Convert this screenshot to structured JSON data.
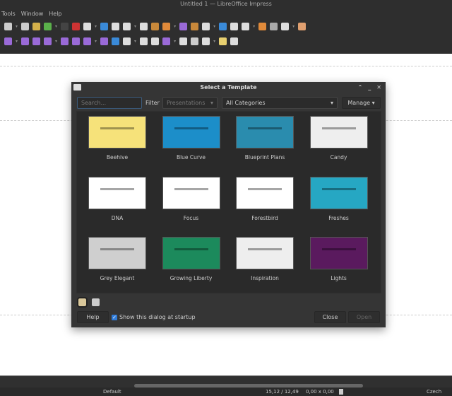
{
  "window": {
    "title": "Untitled 1 — LibreOffice Impress"
  },
  "menu": [
    "Tools",
    "Window",
    "Help"
  ],
  "dialog": {
    "title": "Select a Template",
    "search_placeholder": "Search...",
    "filter_label": "Filter",
    "filter_value": "Presentations",
    "category_value": "All Categories",
    "manage_label": "Manage",
    "templates": [
      {
        "name": "Beehive",
        "color": "#f6e27a"
      },
      {
        "name": "Blue Curve",
        "color": "#1c8ec9"
      },
      {
        "name": "Blueprint Plans",
        "color": "#2a8cae"
      },
      {
        "name": "Candy",
        "color": "#eeeeee"
      },
      {
        "name": "DNA",
        "color": "#ffffff"
      },
      {
        "name": "Focus",
        "color": "#ffffff"
      },
      {
        "name": "Forestbird",
        "color": "#ffffff"
      },
      {
        "name": "Freshes",
        "color": "#26a7c3"
      },
      {
        "name": "Grey Elegant",
        "color": "#cfcfcf"
      },
      {
        "name": "Growing Liberty",
        "color": "#1c8a5c"
      },
      {
        "name": "Inspiration",
        "color": "#eeeeee"
      },
      {
        "name": "Lights",
        "color": "#5a1a5e"
      }
    ],
    "help_label": "Help",
    "startup_label": "Show this dialog at startup",
    "startup_checked": true,
    "close_label": "Close",
    "open_label": "Open"
  },
  "status": {
    "layout": "Default",
    "position": "15,12 / 12,49",
    "size": "0,00 x 0,00",
    "language": "Czech"
  }
}
